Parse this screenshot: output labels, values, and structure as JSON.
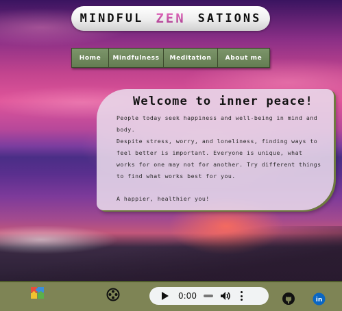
{
  "header": {
    "title_part1": "MINDFUL",
    "title_part2": "ZEN",
    "title_part3": "SATIONS"
  },
  "nav": {
    "items": [
      {
        "label": "Home"
      },
      {
        "label": "Mindfulness"
      },
      {
        "label": "Meditation"
      },
      {
        "label": "About me"
      }
    ]
  },
  "card": {
    "heading": "Welcome to inner peace!",
    "para1": "People today seek happiness and well-being in mind and body.",
    "para2": "Despite stress, worry, and loneliness, finding ways to feel better is important. Everyone is unique, what works for one may not for another. Try different things to find what works best for you.",
    "tagline": "A happier, healthier you!"
  },
  "footer": {
    "icons": [
      "puzzle-icon",
      "film-reel-icon",
      "github-icon",
      "linkedin-icon"
    ],
    "audio": {
      "time": "0:00",
      "progress": 0
    },
    "linkedin_text": "in"
  },
  "colors": {
    "accent_green": "#647d52",
    "footer_bg": "#7e8455",
    "zen_pink": "#d04fa0"
  }
}
